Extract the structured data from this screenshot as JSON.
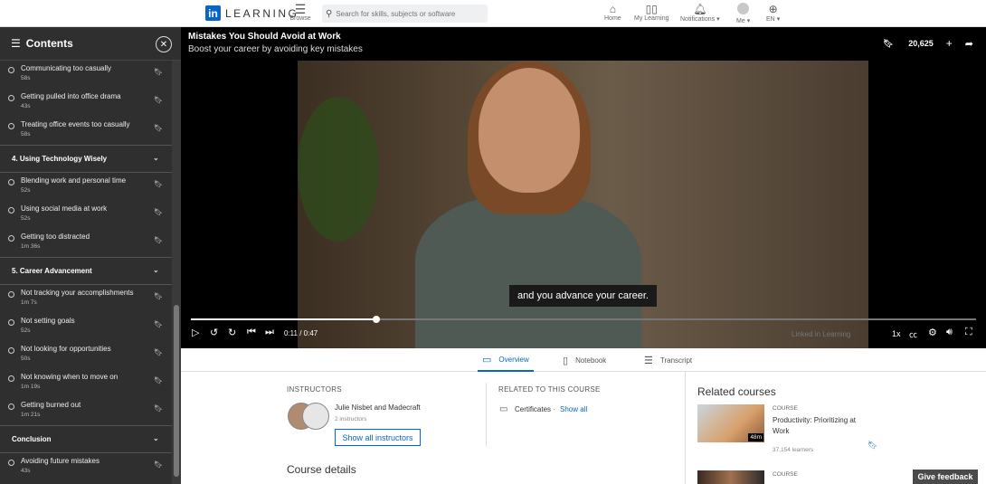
{
  "nav": {
    "logo_text": "LEARNING",
    "logo_mark": "in",
    "browse_label": "Browse",
    "search_placeholder": "Search for skills, subjects or software",
    "home_label": "Home",
    "my_learning_label": "My Learning",
    "notifications_label": "Notifications",
    "me_label": "Me",
    "language_label": "EN"
  },
  "sidebar": {
    "title": "Contents",
    "items": [
      {
        "kind": "video",
        "title": "Communicating too casually",
        "duration": "58s"
      },
      {
        "kind": "video",
        "title": "Getting pulled into office drama",
        "duration": "43s"
      },
      {
        "kind": "video",
        "title": "Treating office events too casually",
        "duration": "58s"
      },
      {
        "kind": "chapter",
        "title": "4. Using Technology Wisely"
      },
      {
        "kind": "video",
        "title": "Blending work and personal time",
        "duration": "52s"
      },
      {
        "kind": "video",
        "title": "Using social media at work",
        "duration": "52s"
      },
      {
        "kind": "video",
        "title": "Getting too distracted",
        "duration": "1m 36s"
      },
      {
        "kind": "chapter",
        "title": "5. Career Advancement"
      },
      {
        "kind": "video",
        "title": "Not tracking your accomplishments",
        "duration": "1m 7s"
      },
      {
        "kind": "video",
        "title": "Not setting goals",
        "duration": "52s"
      },
      {
        "kind": "video",
        "title": "Not looking for opportunities",
        "duration": "50s"
      },
      {
        "kind": "video",
        "title": "Not knowing when to move on",
        "duration": "1m 19s"
      },
      {
        "kind": "video",
        "title": "Getting burned out",
        "duration": "1m 21s"
      },
      {
        "kind": "chapter",
        "title": "Conclusion"
      },
      {
        "kind": "video",
        "title": "Avoiding future mistakes",
        "duration": "43s"
      }
    ]
  },
  "video": {
    "title": "Mistakes You Should Avoid at Work",
    "subtitle": "Boost your career by avoiding key mistakes",
    "saves": "20,625",
    "caption": "and you advance your career.",
    "current_time": "0:11",
    "total_time": "0:47",
    "progress": 0.2364,
    "speed": "1x",
    "watermark": "Linked in Learning"
  },
  "tabs": [
    {
      "label": "Overview",
      "icon": "overview-icon",
      "active": true
    },
    {
      "label": "Notebook",
      "icon": "notebook-icon",
      "active": false
    },
    {
      "label": "Transcript",
      "icon": "transcript-icon",
      "active": false
    }
  ],
  "overview": {
    "instructors_heading": "INSTRUCTORS",
    "instructor_names": "Julie Nisbet and Madecraft",
    "instructor_count": "2 instructors",
    "show_instructors": "Show all instructors",
    "related_heading": "RELATED TO THIS COURSE",
    "certificates": "Certificates",
    "separator": "·",
    "show_all": "Show all",
    "course_details": "Course details"
  },
  "related": {
    "title": "Related courses",
    "courses": [
      {
        "type": "COURSE",
        "name": "Productivity: Prioritizing at Work",
        "duration": "48m",
        "learners": "37,154 learners"
      },
      {
        "type": "COURSE"
      }
    ]
  },
  "feedback_label": "Give feedback",
  "colors": {
    "accent": "#0a66c2",
    "sidebar_bg": "#2f2f2f",
    "player_bg": "#000000"
  }
}
